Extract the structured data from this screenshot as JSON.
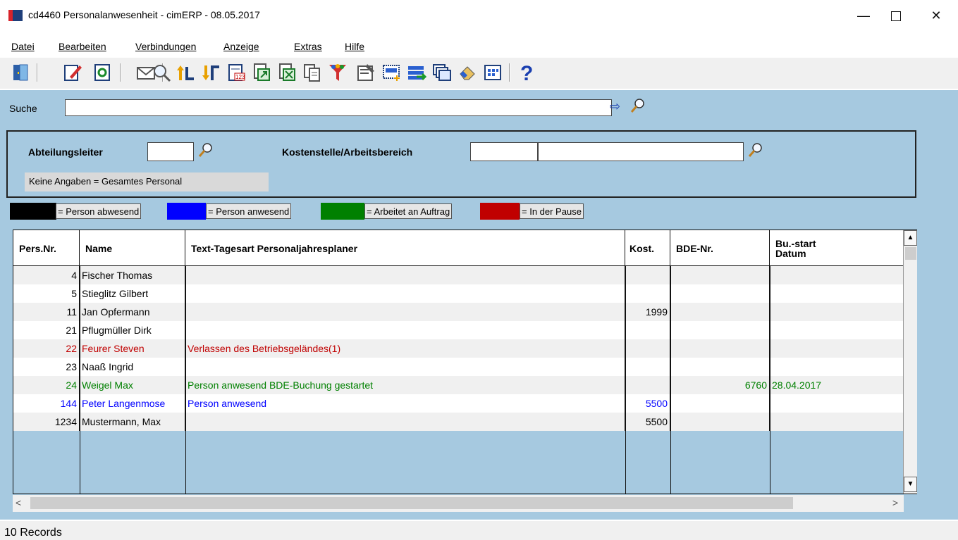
{
  "window": {
    "title": "cd4460 Personalanwesenheit - cimERP - 08.05.2017",
    "minimize": "—",
    "close": "✕"
  },
  "menu": [
    "Datei",
    "Bearbeiten",
    "Verbindungen",
    "Anzeige",
    "Extras",
    "Hilfe"
  ],
  "toolbar_icons": [
    "exit-door-icon",
    "edit-pencil-icon",
    "refresh-icon",
    "envelope-icon",
    "search-magnifier-icon",
    "sort-ascending-icon",
    "sort-descending-icon",
    "calendar-123-icon",
    "export-document-icon",
    "excel-export-icon",
    "copy-document-icon",
    "filter-funnel-icon",
    "settings-form-icon",
    "new-row-icon",
    "import-list-icon",
    "windows-cascade-icon",
    "eraser-icon",
    "grid-view-icon",
    "help-icon"
  ],
  "search": {
    "label": "Suche",
    "value": ""
  },
  "filters": {
    "abteilungsleiter_label": "Abteilungsleiter",
    "kostenstelle_label": "Kostenstelle/Arbeitsbereich",
    "info": "Keine Angaben = Gesamtes Personal"
  },
  "legend": [
    {
      "color": "#000000",
      "text": "= Person abwesend"
    },
    {
      "color": "#0000ff",
      "text": "= Person anwesend"
    },
    {
      "color": "#008000",
      "text": "= Arbeitet an Auftrag"
    },
    {
      "color": "#c00000",
      "text": "= In der Pause"
    }
  ],
  "columns": [
    "Pers.Nr.",
    "Name",
    "Text-Tagesart Personaljahresplaner",
    "Kost.",
    "BDE-Nr.",
    "Bu.-start\nDatum"
  ],
  "rows": [
    {
      "nr": "4",
      "name": "Fischer Thomas",
      "text": "",
      "kost": "",
      "bde": "",
      "datum": "",
      "color": "#000000",
      "bg": "#f0f0f0"
    },
    {
      "nr": "5",
      "name": "Stieglitz Gilbert",
      "text": "",
      "kost": "",
      "bde": "",
      "datum": "",
      "color": "#000000",
      "bg": "#ffffff"
    },
    {
      "nr": "11",
      "name": "Jan Opfermann",
      "text": "",
      "kost": "1999",
      "bde": "",
      "datum": "",
      "color": "#000000",
      "bg": "#f0f0f0"
    },
    {
      "nr": "21",
      "name": "Pflugmüller Dirk",
      "text": "",
      "kost": "",
      "bde": "",
      "datum": "",
      "color": "#000000",
      "bg": "#ffffff"
    },
    {
      "nr": "22",
      "name": "Feurer Steven",
      "text": "Verlassen des Betriebsgeländes(1)",
      "kost": "",
      "bde": "",
      "datum": "",
      "color": "#c00000",
      "bg": "#f0f0f0"
    },
    {
      "nr": "23",
      "name": "Naaß Ingrid",
      "text": "",
      "kost": "",
      "bde": "",
      "datum": "",
      "color": "#000000",
      "bg": "#ffffff"
    },
    {
      "nr": "24",
      "name": "Weigel Max",
      "text": "Person anwesend   BDE-Buchung gestartet",
      "kost": "",
      "bde": "6760",
      "datum": "28.04.2017",
      "color": "#008000",
      "bg": "#f0f0f0"
    },
    {
      "nr": "144",
      "name": "Peter Langenmose",
      "text": "Person anwesend",
      "kost": "5500",
      "bde": "",
      "datum": "",
      "color": "#0000ff",
      "bg": "#ffffff"
    },
    {
      "nr": "1234",
      "name": "Mustermann, Max",
      "text": "",
      "kost": "5500",
      "bde": "",
      "datum": "",
      "color": "#000000",
      "bg": "#f0f0f0"
    }
  ],
  "status": "10 Records"
}
